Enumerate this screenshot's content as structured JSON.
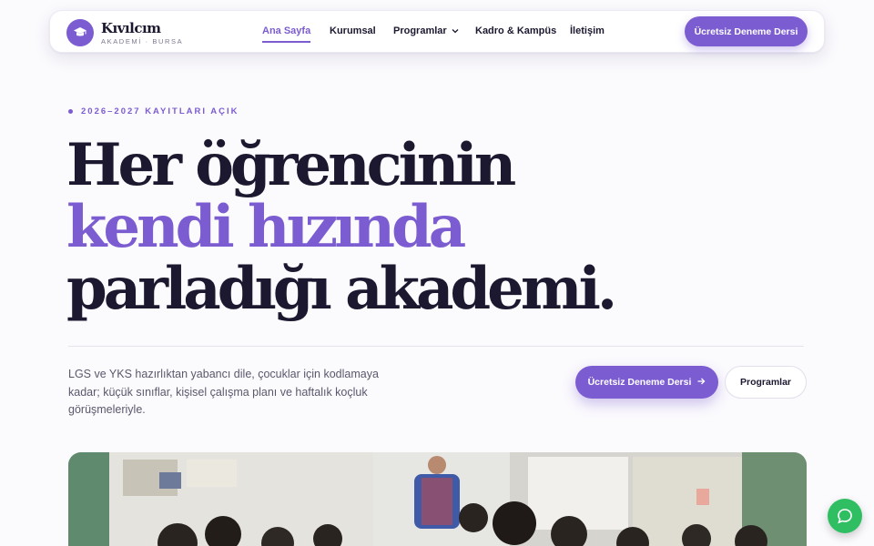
{
  "brand": {
    "name": "Kıvılcım",
    "subtitle": "AKADEMİ · BURSA",
    "logo_icon": "graduation-cap-icon",
    "accent_color": "#7b5cd1"
  },
  "nav": {
    "items": [
      {
        "label": "Ana Sayfa",
        "active": true
      },
      {
        "label": "Kurumsal",
        "active": false
      },
      {
        "label": "Programlar",
        "active": false,
        "has_dropdown": true
      },
      {
        "label": "Kadro & Kampüs",
        "active": false
      },
      {
        "label": "İletişim",
        "active": false
      }
    ],
    "cta_label": "Ücretsiz Deneme Dersi"
  },
  "hero": {
    "eyebrow": "2026–2027 KAYITLARI AÇIK",
    "headline_line1": "Her öğrencinin",
    "headline_line2": "kendi hızında",
    "headline_line3": "parladığı akademi.",
    "lead": "LGS ve YKS hazırlıktan yabancı dile, çocuklar için kodlamaya kadar; küçük sınıflar, kişisel çalışma planı ve haftalık koçluk görüşmeleriyle.",
    "primary_button": "Ücretsiz Deneme Dersi",
    "primary_button_icon": "arrow-right-icon",
    "secondary_button": "Programlar"
  },
  "chat": {
    "icon": "chat-bubble-icon",
    "color": "#2fbf62"
  }
}
